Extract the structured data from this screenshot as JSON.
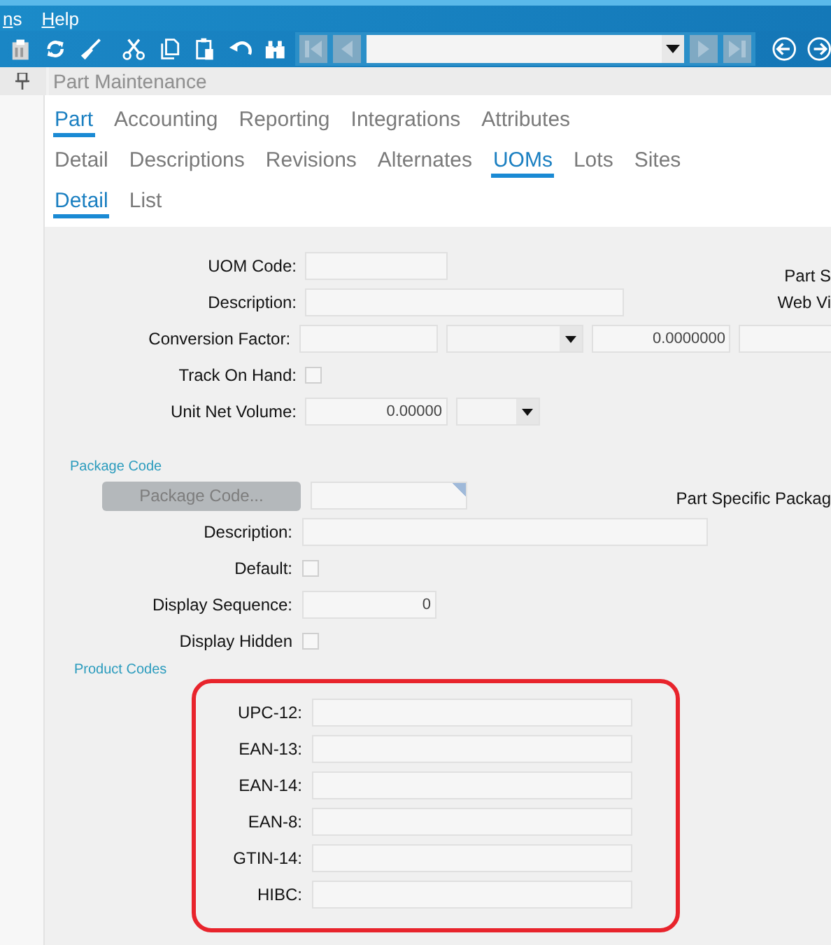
{
  "menu": [
    {
      "label": "ns"
    },
    {
      "label": "Help"
    }
  ],
  "panel_title": "Part Maintenance",
  "tab_rows": [
    {
      "tabs": [
        {
          "label": "Part",
          "selected": true
        },
        {
          "label": "Accounting",
          "selected": false
        },
        {
          "label": "Reporting",
          "selected": false
        },
        {
          "label": "Integrations",
          "selected": false
        },
        {
          "label": "Attributes",
          "selected": false
        }
      ]
    },
    {
      "tabs": [
        {
          "label": "Detail",
          "selected": false
        },
        {
          "label": "Descriptions",
          "selected": false
        },
        {
          "label": "Revisions",
          "selected": false
        },
        {
          "label": "Alternates",
          "selected": false
        },
        {
          "label": "UOMs",
          "selected": true
        },
        {
          "label": "Lots",
          "selected": false
        },
        {
          "label": "Sites",
          "selected": false
        }
      ]
    },
    {
      "tabs": [
        {
          "label": "Detail",
          "selected": true
        },
        {
          "label": "List",
          "selected": false
        }
      ]
    }
  ],
  "sections": [
    {
      "rows": [
        {
          "label": "UOM Code:",
          "controls": [
            {
              "kind": "code"
            }
          ],
          "side_text": "Part S"
        },
        {
          "label": "Description:",
          "controls": [
            {
              "kind": "desc"
            }
          ],
          "side_text": "Web Vi"
        },
        {
          "label": "Conversion Factor:",
          "controls": [
            {
              "kind": "code"
            },
            {
              "kind": "combo"
            },
            {
              "kind": "number",
              "value": "0.0000000"
            },
            {
              "kind": "edge"
            }
          ]
        },
        {
          "label": "Track On Hand:",
          "controls": [
            {
              "kind": "checkbox",
              "checked": false
            }
          ]
        },
        {
          "label": "Unit Net Volume:",
          "controls": [
            {
              "kind": "number",
              "value": "0.00000"
            },
            {
              "kind": "combo-small"
            }
          ]
        }
      ]
    },
    {
      "group_label": "Package Code",
      "rows": [
        {
          "button": {
            "label": "Package Code...",
            "disabled": true
          },
          "controls": [
            {
              "kind": "lookup"
            }
          ],
          "side_text": "Part Specific Packag"
        },
        {
          "label": "Description:",
          "controls": [
            {
              "kind": "desc-wide"
            }
          ]
        },
        {
          "label": "Default:",
          "controls": [
            {
              "kind": "checkbox",
              "checked": false
            }
          ]
        },
        {
          "label": "Display Sequence:",
          "controls": [
            {
              "kind": "seq",
              "value": "0"
            }
          ]
        },
        {
          "label": "Display Hidden",
          "controls": [
            {
              "kind": "checkbox",
              "checked": false
            }
          ]
        }
      ]
    },
    {
      "group_label": "Product Codes",
      "highlighted": true,
      "rows": [
        {
          "label": "UPC-12:",
          "controls": [
            {
              "kind": "barcode"
            }
          ]
        },
        {
          "label": "EAN-13:",
          "controls": [
            {
              "kind": "barcode"
            }
          ]
        },
        {
          "label": "EAN-14:",
          "controls": [
            {
              "kind": "barcode"
            }
          ]
        },
        {
          "label": "EAN-8:",
          "controls": [
            {
              "kind": "barcode"
            }
          ]
        },
        {
          "label": "GTIN-14:",
          "controls": [
            {
              "kind": "barcode"
            }
          ]
        },
        {
          "label": "HIBC:",
          "controls": [
            {
              "kind": "barcode"
            }
          ]
        }
      ]
    }
  ]
}
